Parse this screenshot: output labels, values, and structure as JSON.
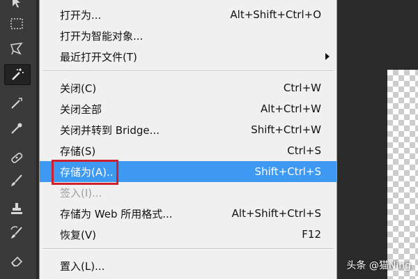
{
  "colors": {
    "menu_bg": "#f0f0f0",
    "highlight_bg": "#3d99f2",
    "annotation_box": "#d0202c",
    "workspace_bg": "#2b2b2b",
    "toolbar_bg": "#3a3a3a",
    "disabled_text": "#9e9e9e"
  },
  "toolbar": {
    "tools": [
      {
        "icon": "move-arrow-icon"
      },
      {
        "icon": "rectangular-marquee-icon"
      },
      {
        "icon": "lasso-icon"
      },
      {
        "icon": "magic-wand-icon",
        "active": true
      },
      {
        "icon": "crop-icon"
      },
      {
        "icon": "eyedropper-icon"
      },
      {
        "icon": "healing-brush-icon"
      },
      {
        "icon": "brush-icon"
      },
      {
        "icon": "clone-stamp-icon"
      },
      {
        "icon": "history-brush-icon"
      },
      {
        "icon": "eraser-icon"
      }
    ]
  },
  "menu": {
    "open_as": {
      "label": "打开为...",
      "shortcut": "Alt+Shift+Ctrl+O"
    },
    "open_as_smart_object": {
      "label": "打开为智能对象..."
    },
    "recent_files": {
      "label": "最近打开文件(T)"
    },
    "close": {
      "label": "关闭(C)",
      "shortcut": "Ctrl+W"
    },
    "close_all": {
      "label": "关闭全部",
      "shortcut": "Alt+Ctrl+W"
    },
    "close_go_bridge": {
      "label": "关闭并转到 Bridge...",
      "shortcut": "Shift+Ctrl+W"
    },
    "save": {
      "label": "存储(S)",
      "shortcut": "Ctrl+S"
    },
    "save_as": {
      "label": "存储为(A)..",
      "shortcut": "Shift+Ctrl+S"
    },
    "check_in": {
      "label": "签入(I)..."
    },
    "save_for_web": {
      "label": "存储为 Web 所用格式...",
      "shortcut": "Alt+Shift+Ctrl+S"
    },
    "revert": {
      "label": "恢复(V)",
      "shortcut": "F12"
    },
    "place": {
      "label": "置入(L)..."
    }
  },
  "watermark": "头条 @猫Ning"
}
